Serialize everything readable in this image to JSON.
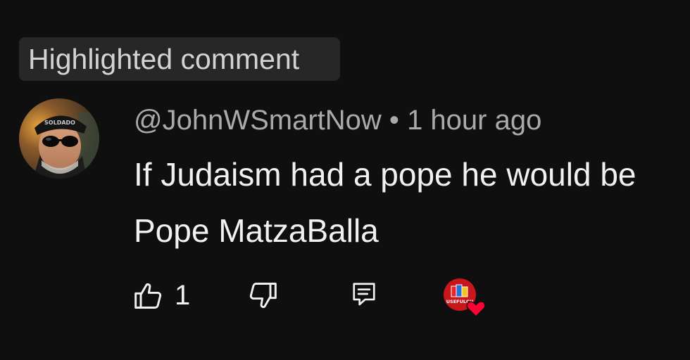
{
  "badge": {
    "label": "Highlighted comment"
  },
  "comment": {
    "author": "@JohnWSmartNow",
    "separator": "•",
    "time": "1 hour ago",
    "text": "If Judaism had a pope he would be Pope MatzaBalla",
    "avatar_icon": "user-avatar-sunglasses",
    "avatar_cap_text": "SOLDADO"
  },
  "actions": {
    "like_count": "1",
    "like_icon": "thumbs-up-icon",
    "dislike_icon": "thumbs-down-icon",
    "reply_icon": "reply-icon",
    "heart_icon": "creator-heart-icon",
    "creator_avatar_text": "USEFULCH"
  },
  "colors": {
    "background": "#0f0f0f",
    "chip": "#272727",
    "heart": "#ff0033",
    "creator_avatar": "#c8161d"
  }
}
